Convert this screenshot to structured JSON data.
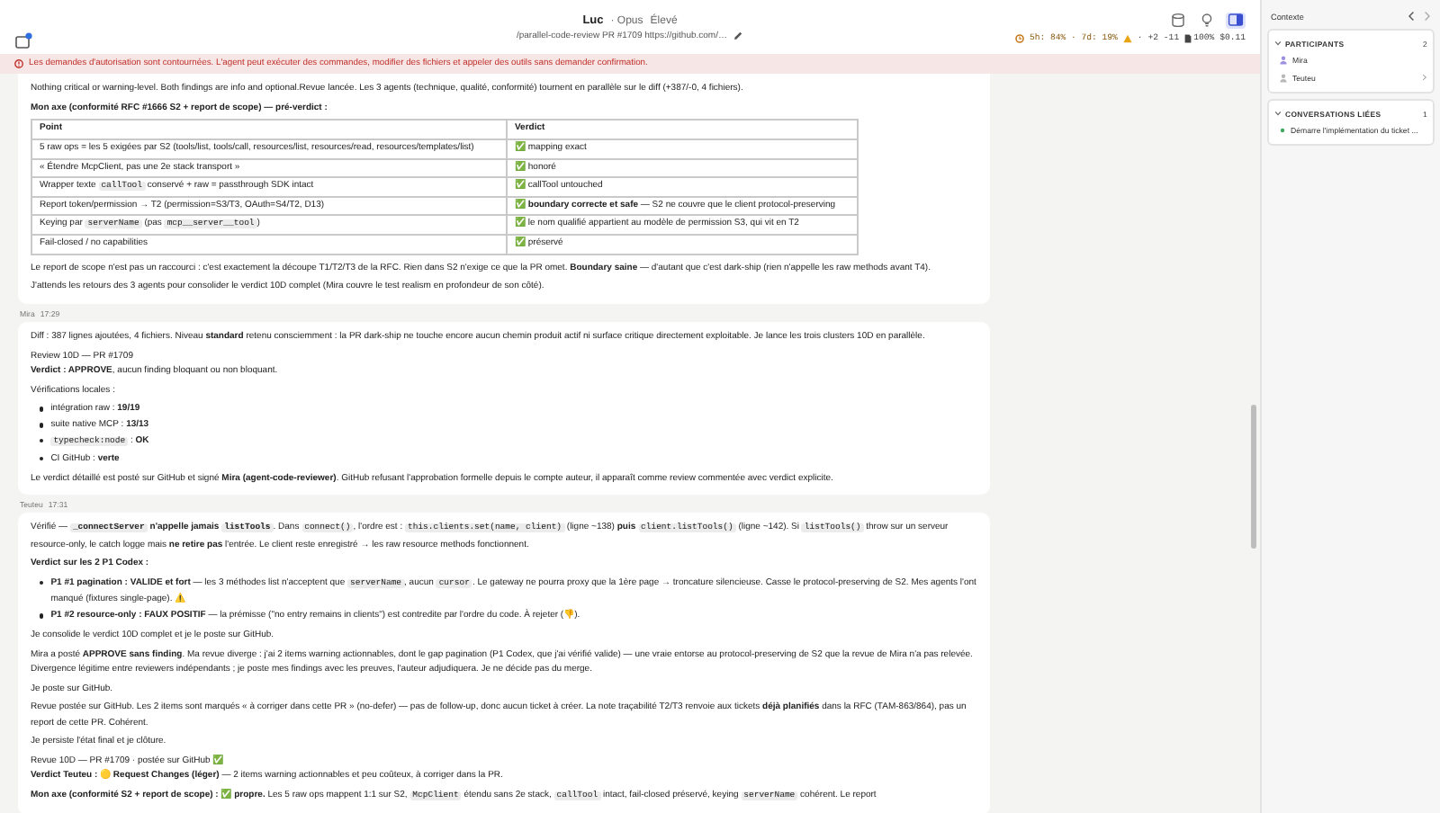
{
  "window": {
    "title": "Luc",
    "model": "· Opus",
    "effort": "Élevé",
    "subtitle": "/parallel-code-review PR #1709 https://github.com/…"
  },
  "toolbar": [
    {
      "kind": "database",
      "selected": false
    },
    {
      "kind": "bulb",
      "selected": false
    },
    {
      "kind": "sidebar",
      "selected": true
    }
  ],
  "status": {
    "quota": "5h: 84% · 7d: 19%",
    "warning": true,
    "separator": "·",
    "diff": "+2 -11",
    "context": "100%",
    "cost": "$0.11"
  },
  "banner": {
    "text": "Les demandes d'autorisation sont contournées. L'agent peut exécuter des commandes, modifier des fichiers et appeler des outils sans demander confirmation."
  },
  "messages": [
    {
      "blocks": [
        {
          "kind": "paragraph",
          "segments": [
            {
              "kind": "plain",
              "text": "Nothing critical or warning-level. Both findings are info and optional.Revue lancée. Les 3 agents (technique, qualité, conformité) tournent en parallèle sur le diff (+387/-0, 4 fichiers)."
            }
          ]
        },
        {
          "kind": "paragraph",
          "segments": [
            {
              "kind": "bold",
              "text": "Mon axe (conformité RFC #1666 S2 + report de scope) — pré-verdict :"
            }
          ]
        },
        {
          "kind": "table",
          "columns": [
            "Point",
            "Verdict"
          ],
          "rows": [
            {
              "point": [
                {
                  "kind": "plain",
                  "text": "5 raw ops = les 5 exigées par S2 (tools/list, tools/call, resources/list, resources/read, resources/templates/list)"
                }
              ],
              "verdict": [
                {
                  "kind": "plain",
                  "text": "✅ mapping exact"
                }
              ]
            },
            {
              "point": [
                {
                  "kind": "plain",
                  "text": "« Étendre McpClient, pas une 2e stack transport »"
                }
              ],
              "verdict": [
                {
                  "kind": "plain",
                  "text": "✅ honoré"
                }
              ]
            },
            {
              "point": [
                {
                  "kind": "plain",
                  "text": "Wrapper texte "
                },
                {
                  "kind": "code",
                  "text": "callTool"
                },
                {
                  "kind": "plain",
                  "text": " conservé + raw = passthrough SDK intact"
                }
              ],
              "verdict": [
                {
                  "kind": "plain",
                  "text": "✅ callTool untouched"
                }
              ]
            },
            {
              "point": [
                {
                  "kind": "plain",
                  "text": "Report token/permission → T2 (permission=S3/T3, OAuth=S4/T2, D13)"
                }
              ],
              "verdict": [
                {
                  "kind": "plain",
                  "text": "✅ "
                },
                {
                  "kind": "bold",
                  "text": "boundary correcte et safe"
                },
                {
                  "kind": "plain",
                  "text": " — S2 ne couvre que le client protocol-preserving"
                }
              ]
            },
            {
              "point": [
                {
                  "kind": "plain",
                  "text": "Keying par "
                },
                {
                  "kind": "code",
                  "text": "serverName"
                },
                {
                  "kind": "plain",
                  "text": " (pas "
                },
                {
                  "kind": "code",
                  "text": "mcp__server__tool"
                },
                {
                  "kind": "plain",
                  "text": ")"
                }
              ],
              "verdict": [
                {
                  "kind": "plain",
                  "text": "✅ le nom qualifié appartient au modèle de permission S3, qui vit en T2"
                }
              ]
            },
            {
              "point": [
                {
                  "kind": "plain",
                  "text": "Fail-closed / no capabilities"
                }
              ],
              "verdict": [
                {
                  "kind": "plain",
                  "text": "✅ préservé"
                }
              ]
            }
          ]
        },
        {
          "kind": "paragraph",
          "segments": [
            {
              "kind": "plain",
              "text": "Le report de scope n'est pas un raccourci : c'est exactement la découpe T1/T2/T3 de la RFC. Rien dans S2 n'exige ce que la PR omet. "
            },
            {
              "kind": "bold",
              "text": "Boundary saine"
            },
            {
              "kind": "plain",
              "text": " — d'autant que c'est dark-ship (rien n'appelle les raw methods avant T4)."
            }
          ]
        },
        {
          "kind": "paragraph",
          "segments": [
            {
              "kind": "plain",
              "text": "J'attends les retours des 3 agents pour consolider le verdict 10D complet (Mira couvre le test realism en profondeur de son côté)."
            }
          ]
        }
      ]
    },
    {
      "author": "Mira",
      "time": "17:29",
      "blocks": [
        {
          "kind": "paragraph",
          "segments": [
            {
              "kind": "plain",
              "text": "Diff : 387 lignes ajoutées, 4 fichiers. Niveau "
            },
            {
              "kind": "bold",
              "text": "standard"
            },
            {
              "kind": "plain",
              "text": " retenu consciemment : la PR dark-ship ne touche encore aucun chemin produit actif ni surface critique directement exploitable. Je lance les trois clusters 10D en parallèle."
            }
          ]
        },
        {
          "kind": "lines",
          "lines": [
            [
              {
                "kind": "plain",
                "text": "Review 10D — PR #1709"
              }
            ],
            [
              {
                "kind": "bold",
                "text": "Verdict : APPROVE"
              },
              {
                "kind": "plain",
                "text": ", aucun finding bloquant ou non bloquant."
              }
            ]
          ]
        },
        {
          "kind": "paragraph",
          "segments": [
            {
              "kind": "plain",
              "text": "Vérifications locales :"
            }
          ]
        },
        {
          "kind": "list",
          "items": [
            [
              {
                "kind": "plain",
                "text": "intégration raw : "
              },
              {
                "kind": "bold",
                "text": "19/19"
              }
            ],
            [
              {
                "kind": "plain",
                "text": "suite native MCP : "
              },
              {
                "kind": "bold",
                "text": "13/13"
              }
            ],
            [
              {
                "kind": "code",
                "text": "typecheck:node"
              },
              {
                "kind": "plain",
                "text": " : "
              },
              {
                "kind": "bold",
                "text": "OK"
              }
            ],
            [
              {
                "kind": "plain",
                "text": "CI GitHub : "
              },
              {
                "kind": "bold",
                "text": "verte"
              }
            ]
          ]
        },
        {
          "kind": "paragraph",
          "segments": [
            {
              "kind": "plain",
              "text": "Le verdict détaillé est posté sur GitHub et signé "
            },
            {
              "kind": "bold",
              "text": "Mira (agent-code-reviewer)"
            },
            {
              "kind": "plain",
              "text": ". GitHub refusant l'approbation formelle depuis le compte auteur, il apparaît comme review commentée avec verdict explicite."
            }
          ]
        }
      ]
    },
    {
      "author": "Teuteu",
      "time": "17:31",
      "blocks": [
        {
          "kind": "paragraph",
          "segments": [
            {
              "kind": "plain",
              "text": "Vérifié — "
            },
            {
              "kind": "boldcode",
              "text": "_connectServer"
            },
            {
              "kind": "bold",
              "text": " n'appelle jamais "
            },
            {
              "kind": "boldcode",
              "text": "listTools"
            },
            {
              "kind": "plain",
              "text": ". Dans "
            },
            {
              "kind": "code",
              "text": "connect()"
            },
            {
              "kind": "plain",
              "text": ", l'ordre est : "
            },
            {
              "kind": "code",
              "text": "this.clients.set(name, client)"
            },
            {
              "kind": "plain",
              "text": " (ligne ~138) "
            },
            {
              "kind": "bold",
              "text": "puis "
            },
            {
              "kind": "code",
              "text": "client.listTools()"
            },
            {
              "kind": "plain",
              "text": " (ligne ~142). Si "
            },
            {
              "kind": "code",
              "text": "listTools()"
            },
            {
              "kind": "plain",
              "text": " throw sur un serveur resource-only, le catch logge mais "
            },
            {
              "kind": "bold",
              "text": "ne retire pas"
            },
            {
              "kind": "plain",
              "text": " l'entrée. Le client reste enregistré → les raw resource methods fonctionnent."
            }
          ]
        },
        {
          "kind": "paragraph",
          "segments": [
            {
              "kind": "bold",
              "text": "Verdict sur les 2 P1 Codex :"
            }
          ]
        },
        {
          "kind": "list",
          "items": [
            [
              {
                "kind": "bold",
                "text": "P1 #1 pagination : VALIDE et fort"
              },
              {
                "kind": "plain",
                "text": " — les 3 méthodes list n'acceptent que "
              },
              {
                "kind": "code",
                "text": "serverName"
              },
              {
                "kind": "plain",
                "text": ", aucun "
              },
              {
                "kind": "code",
                "text": "cursor"
              },
              {
                "kind": "plain",
                "text": ". Le gateway ne pourra proxy que la 1ère page → troncature silencieuse. Casse le protocol-preserving de S2. Mes agents l'ont manqué (fixtures single-page). ⚠️"
              }
            ],
            [
              {
                "kind": "bold",
                "text": "P1 #2 resource-only : FAUX POSITIF"
              },
              {
                "kind": "plain",
                "text": " — la prémisse (\"no entry remains in clients\") est contredite par l'ordre du code. À rejeter (👎)."
              }
            ]
          ]
        },
        {
          "kind": "paragraph",
          "segments": [
            {
              "kind": "plain",
              "text": "Je consolide le verdict 10D complet et je le poste sur GitHub."
            }
          ]
        },
        {
          "kind": "paragraph",
          "segments": [
            {
              "kind": "plain",
              "text": "Mira a posté "
            },
            {
              "kind": "bold",
              "text": "APPROVE sans finding"
            },
            {
              "kind": "plain",
              "text": ". Ma revue diverge : j'ai 2 items warning actionnables, dont le gap pagination (P1 Codex, que j'ai vérifié valide) — une vraie entorse au protocol-preserving de S2 que la revue de Mira n'a pas relevée. Divergence légitime entre reviewers indépendants ; je poste mes findings avec les preuves, l'auteur adjudiquera. Je ne décide pas du merge."
            }
          ]
        },
        {
          "kind": "paragraph",
          "segments": [
            {
              "kind": "plain",
              "text": "Je poste sur GitHub."
            }
          ]
        },
        {
          "kind": "paragraph",
          "segments": [
            {
              "kind": "plain",
              "text": "Revue postée sur GitHub. Les 2 items sont marqués « à corriger dans cette PR » (no-defer) — pas de follow-up, donc aucun ticket à créer. La note traçabilité T2/T3 renvoie aux tickets "
            },
            {
              "kind": "bold",
              "text": "déjà planifiés"
            },
            {
              "kind": "plain",
              "text": " dans la RFC (TAM-863/864), pas un report de cette PR. Cohérent."
            }
          ]
        },
        {
          "kind": "paragraph",
          "segments": [
            {
              "kind": "plain",
              "text": "Je persiste l'état final et je clôture."
            }
          ]
        },
        {
          "kind": "lines",
          "lines": [
            [
              {
                "kind": "plain",
                "text": "Revue 10D — PR #1709 · postée sur GitHub ✅"
              }
            ],
            [
              {
                "kind": "bold",
                "text": "Verdict Teuteu :"
              },
              {
                "kind": "plain",
                "text": " 🟡 "
              },
              {
                "kind": "bold",
                "text": "Request Changes (léger)"
              },
              {
                "kind": "plain",
                "text": " — 2 items warning actionnables et peu coûteux, à corriger dans la PR."
              }
            ]
          ]
        },
        {
          "kind": "paragraph",
          "segments": [
            {
              "kind": "bold",
              "text": "Mon axe (conformité S2 + report de scope) :"
            },
            {
              "kind": "plain",
              "text": " ✅ "
            },
            {
              "kind": "bold",
              "text": "propre."
            },
            {
              "kind": "plain",
              "text": " Les 5 raw ops mappent 1:1 sur S2, "
            },
            {
              "kind": "code",
              "text": "McpClient"
            },
            {
              "kind": "plain",
              "text": " étendu sans 2e stack, "
            },
            {
              "kind": "code",
              "text": "callTool"
            },
            {
              "kind": "plain",
              "text": " intact, fail-closed préservé, keying "
            },
            {
              "kind": "code",
              "text": "serverName"
            },
            {
              "kind": "plain",
              "text": " cohérent. Le report"
            }
          ]
        }
      ]
    }
  ],
  "sidebar": {
    "title": "Contexte",
    "sections": [
      {
        "title": "PARTICIPANTS",
        "count": "2",
        "expanded": true,
        "items": [
          {
            "kind": "person",
            "label": "Mira",
            "color": "#9d8fe0",
            "has_children": false
          },
          {
            "kind": "person",
            "label": "Teuteu",
            "color": "#b8b8b8",
            "has_children": true
          }
        ]
      },
      {
        "title": "CONVERSATIONS LIÉES",
        "count": "1",
        "expanded": true,
        "items": [
          {
            "kind": "conversation",
            "label": "Démarre l'implémentation du ticket ...",
            "color": "#3daa5c",
            "has_children": false
          }
        ]
      }
    ]
  }
}
